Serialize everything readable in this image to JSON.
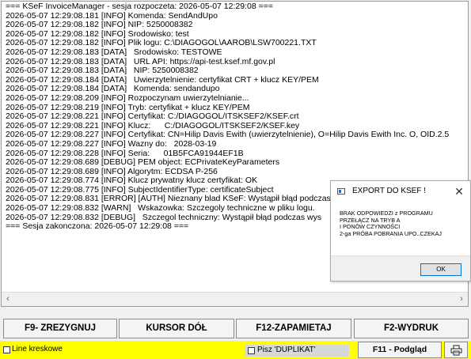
{
  "log": {
    "lines": [
      "=== KSeF InvoiceManager - sesja rozpoczeta: 2026-05-07 12:29:08 ===",
      "2026-05-07 12:29:08.181 [INFO] Komenda: SendAndUpo",
      "2026-05-07 12:29:08.182 [INFO] NIP: 5250008382",
      "2026-05-07 12:29:08.182 [INFO] Srodowisko: test",
      "2026-05-07 12:29:08.182 [INFO] Plik logu: C:\\DIAGOGOL\\AAROB\\LSW700221.TXT",
      "2026-05-07 12:29:08.183 [DATA]   Srodowisko: TESTOWE",
      "2026-05-07 12:29:08.183 [DATA]   URL API: https://api-test.ksef.mf.gov.pl",
      "2026-05-07 12:29:08.183 [DATA]   NIP: 5250008382",
      "2026-05-07 12:29:08.184 [DATA]   Uwierzytelnienie: certyfikat CRT + klucz KEY/PEM",
      "2026-05-07 12:29:08.184 [DATA]   Komenda: sendandupo",
      "2026-05-07 12:29:08.209 [INFO] Rozpoczynam uwierzytelnianie...",
      "2026-05-07 12:29:08.219 [INFO] Tryb: certyfikat + klucz KEY/PEM",
      "2026-05-07 12:29:08.221 [INFO] Certyfikat: C:/DIAGOGOL/ITSKSEF2/KSEF.crt",
      "2026-05-07 12:29:08.221 [INFO] Klucz:      C:/DIAGOGOL/ITSKSEF2/KSEF.key",
      "2026-05-07 12:29:08.227 [INFO] Certyfikat: CN=Hilip Davis Ewith (uwierzytelnienie), O=Hilip Davis Ewith Inc. O, OID.2.5",
      "2026-05-07 12:29:08.227 [INFO] Wazny do:   2028-03-19",
      "2026-05-07 12:29:08.228 [INFO] Seria:      01B5FCA91944EF1B",
      "2026-05-07 12:29:08.689 [DEBUG] PEM object: ECPrivateKeyParameters",
      "2026-05-07 12:29:08.689 [INFO] Algorytm: ECDSA P-256",
      "2026-05-07 12:29:08.774 [INFO] Klucz prywatny klucz certyfikat: OK",
      "2026-05-07 12:29:08.775 [INFO] SubjectIdentifierType: certificateSubject",
      "2026-05-07 12:29:08.831 [ERROR] [AUTH] Nieznany blad KSeF: Wystąpił błąd podczas",
      "2026-05-07 12:29:08.832 [WARN]   Wskazowka: Szczegoly techniczne w pliku logu.",
      "2026-05-07 12:29:08.832 [DEBUG]   Szczegol techniczny: Wystąpił błąd podczas wys",
      "=== Sesja zakonczona: 2026-05-07 12:29:08 ==="
    ]
  },
  "scrollbar": {
    "left_arrow": "‹",
    "right_arrow": "›"
  },
  "dialog": {
    "title": "EXPORT DO KSEF !",
    "close_glyph": "✕",
    "message_lines": [
      "BRAK ODPOWIEDZI z PROGRAMU",
      "PRZEŁĄCZ NA TRYB A",
      "I PONÓW CZYNNOŚCI",
      "2-ga PRÓBA POBRANIA UPO..CZEKAJ"
    ],
    "ok_label": "OK"
  },
  "buttons": {
    "f9": "F9- ZREZYGNUJ",
    "kursor": "KURSOR DÓŁ",
    "f12": "F12-ZAPAMIETAJ",
    "f2": "F2-WYDRUK"
  },
  "bottom": {
    "line_checkbox_label": "Line kreskowe",
    "pisz_checkbox_label": "Pisz 'DUPLIKAT'",
    "f11_label": "F11 - Podgląd",
    "print_icon": "printer-icon",
    "bar_color": "#ffff00"
  }
}
